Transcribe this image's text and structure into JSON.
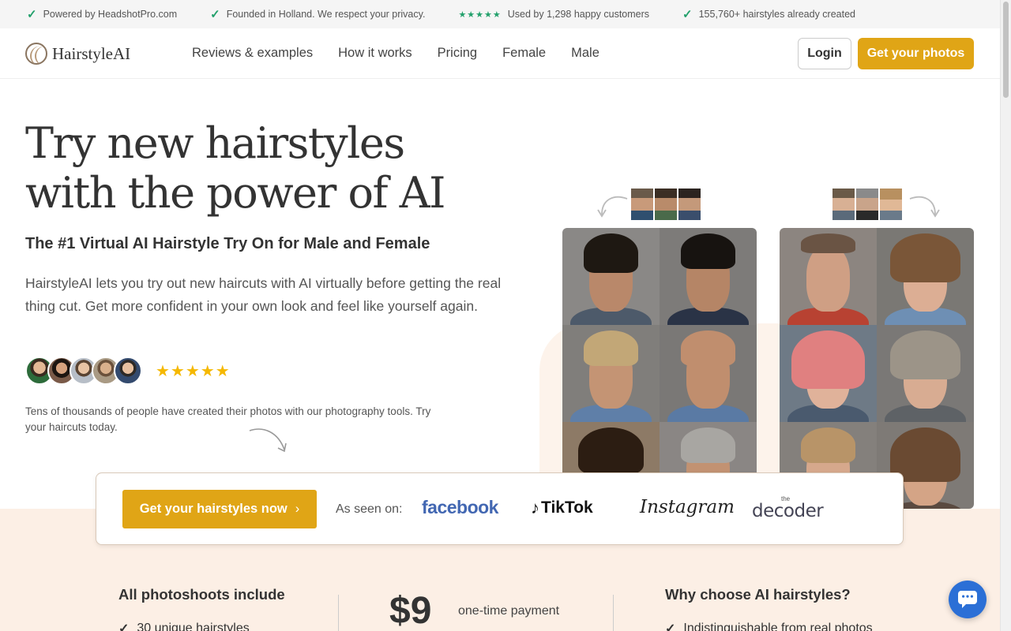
{
  "topbar": {
    "items": [
      "Powered by HeadshotPro.com",
      "Founded in Holland. We respect your privacy.",
      "Used by 1,298 happy customers",
      "155,760+ hairstyles already created"
    ],
    "stars": "★★★★★"
  },
  "nav": {
    "logo": "HairstyleAI",
    "links": [
      "Reviews & examples",
      "How it works",
      "Pricing",
      "Female",
      "Male"
    ],
    "login": "Login",
    "cta": "Get your photos"
  },
  "hero": {
    "title_line1": "Try new hairstyles",
    "title_line2": "with the power of AI",
    "subtitle": "The #1 Virtual AI Hairstyle Try On for Male and Female",
    "description": "HairstyleAI lets you try out new haircuts with AI virtually before getting the real thing cut. Get more confident in your own look and feel like yourself again.",
    "rating": "★★★★★",
    "social_proof": "Tens of thousands of people have created their photos with our photography tools. Try your haircuts today."
  },
  "cta_card": {
    "button": "Get your hairstyles now",
    "chevron": "›",
    "seen_on": "As seen on:",
    "logos": [
      "facebook",
      "TikTok",
      "Instagram",
      "the",
      "decoder"
    ]
  },
  "band": {
    "col1_title": "All photoshoots include",
    "col1_item": "30 unique hairstyles",
    "price": "$9",
    "price_note": "one-time payment",
    "col3_title": "Why choose AI hairstyles?",
    "col3_item": "Indistinguishable from real photos"
  },
  "colors": {
    "accent": "#e0a516",
    "check": "#22a06b",
    "peach": "#fcefe5",
    "chat": "#2b6fd6"
  }
}
